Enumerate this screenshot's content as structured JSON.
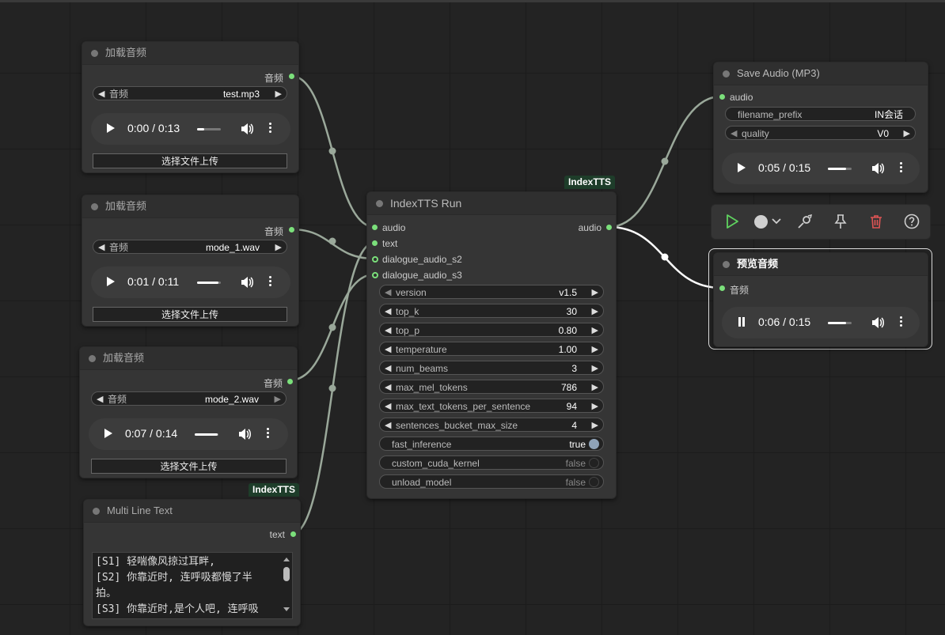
{
  "nodes": {
    "load1": {
      "title": "加载音频",
      "output": "音频",
      "combo_label": "音频",
      "combo_value": "test.mp3",
      "player_time": "0:00 / 0:13",
      "player_progress": 0.3,
      "upload": "选择文件上传"
    },
    "load2": {
      "title": "加载音频",
      "output": "音频",
      "combo_label": "音频",
      "combo_value": "mode_1.wav",
      "player_time": "0:01 / 0:11",
      "player_progress": 0.9,
      "upload": "选择文件上传"
    },
    "load3": {
      "title": "加载音频",
      "output": "音频",
      "combo_label": "音频",
      "combo_value": "mode_2.wav",
      "player_time": "0:07 / 0:14",
      "player_progress": 0.95,
      "upload": "选择文件上传"
    },
    "text": {
      "badge": "IndexTTS",
      "title": "Multi Line Text",
      "output": "text",
      "lines": [
        "[S1] 轻喘像风掠过耳畔,",
        "[S2] 你靠近时, 连呼吸都慢了半",
        "拍。",
        "[S3] 你靠近时,是个人吧, 连呼吸"
      ]
    },
    "run": {
      "badge": "IndexTTS",
      "title": "IndexTTS Run",
      "inputs": [
        "audio",
        "text",
        "dialogue_audio_s2",
        "dialogue_audio_s3"
      ],
      "output": "audio",
      "widgets": [
        {
          "label": "version",
          "value": "v1.5"
        },
        {
          "label": "top_k",
          "value": "30"
        },
        {
          "label": "top_p",
          "value": "0.80"
        },
        {
          "label": "temperature",
          "value": "1.00"
        },
        {
          "label": "num_beams",
          "value": "3"
        },
        {
          "label": "max_mel_tokens",
          "value": "786"
        },
        {
          "label": "max_text_tokens_per_sentence",
          "value": "94"
        },
        {
          "label": "sentences_bucket_max_size",
          "value": "4"
        }
      ],
      "toggles": [
        {
          "label": "fast_inference",
          "value": "true"
        },
        {
          "label": "custom_cuda_kernel",
          "value": "false"
        },
        {
          "label": "unload_model",
          "value": "false"
        }
      ]
    },
    "save": {
      "title": "Save Audio (MP3)",
      "input": "audio",
      "filename_label": "filename_prefix",
      "filename_value": "IN会话",
      "quality_label": "quality",
      "quality_value": "V0",
      "player_time": "0:05 / 0:15",
      "player_progress": 0.75
    },
    "preview": {
      "title": "预览音频",
      "input": "音频",
      "player_time": "0:06 / 0:15",
      "player_progress": 0.75
    }
  },
  "toolbar": {
    "buttons": [
      "run-icon",
      "color-icon",
      "bypass-icon",
      "pin-icon",
      "delete-icon",
      "help-icon"
    ],
    "colors": {
      "run": "#5fd35f",
      "delete": "#e05555",
      "default": "#cfcfcf"
    }
  },
  "colors": {
    "slot": "#7be07b",
    "wire": "#9aa89a",
    "wire_active": "#ffffff",
    "badge_bg": "#1e3d2a"
  }
}
